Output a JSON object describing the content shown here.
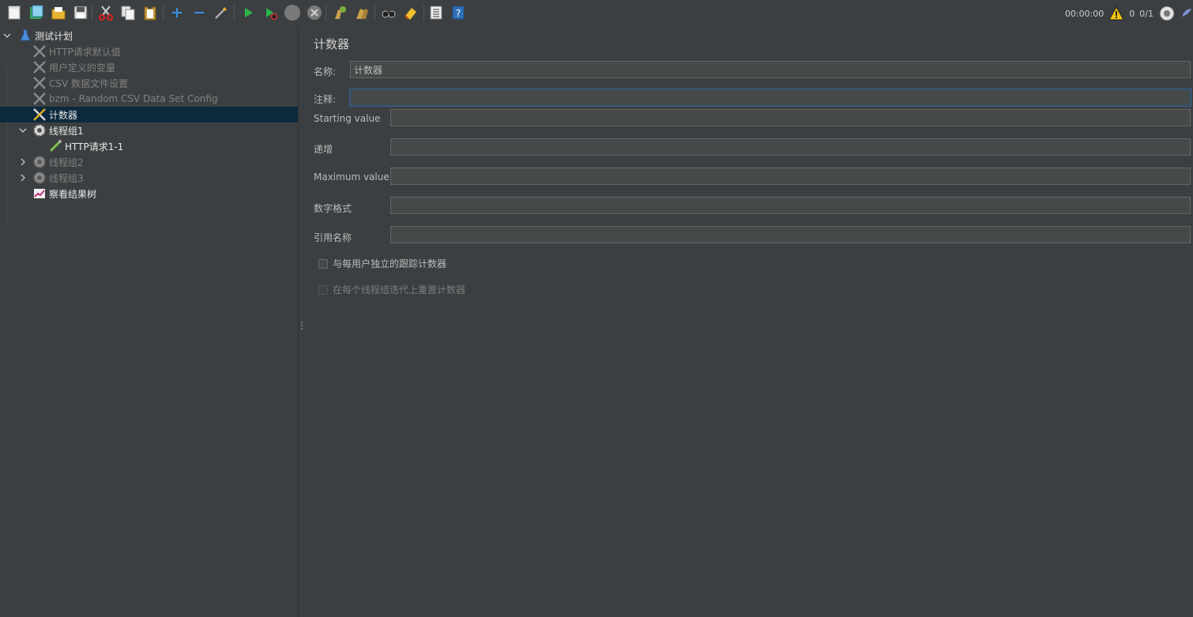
{
  "toolbar": {
    "status": {
      "timer": "00:00:00",
      "warnings": "0",
      "threads": "0/1"
    }
  },
  "tree": {
    "items": [
      {
        "label": "测试计划"
      },
      {
        "label": "HTTP请求默认值"
      },
      {
        "label": "用户定义的变量"
      },
      {
        "label": "CSV 数据文件设置"
      },
      {
        "label": "bzm - Random CSV Data Set Config"
      },
      {
        "label": "计数器"
      },
      {
        "label": "线程组1"
      },
      {
        "label": "HTTP请求1-1"
      },
      {
        "label": "线程组2"
      },
      {
        "label": "线程组3"
      },
      {
        "label": "察看结果树"
      }
    ]
  },
  "panel": {
    "title": "计数器",
    "name_label": "名称:",
    "name_value": "计数器",
    "comment_label": "注释:",
    "comment_value": "",
    "starting_label": "Starting value",
    "starting_value": "",
    "increment_label": "递增",
    "increment_value": "",
    "maximum_label": "Maximum value",
    "maximum_value": "",
    "format_label": "数字格式",
    "format_value": "",
    "refname_label": "引用名称",
    "refname_value": "",
    "per_user_label": "与每用户独立的跟踪计数器",
    "reset_label": "在每个线程组迭代上重置计数器"
  },
  "colors": {
    "background": "#3c3f41",
    "selection": "#0d293e",
    "field_bg": "#45494a",
    "focus_border": "#3d6185"
  }
}
